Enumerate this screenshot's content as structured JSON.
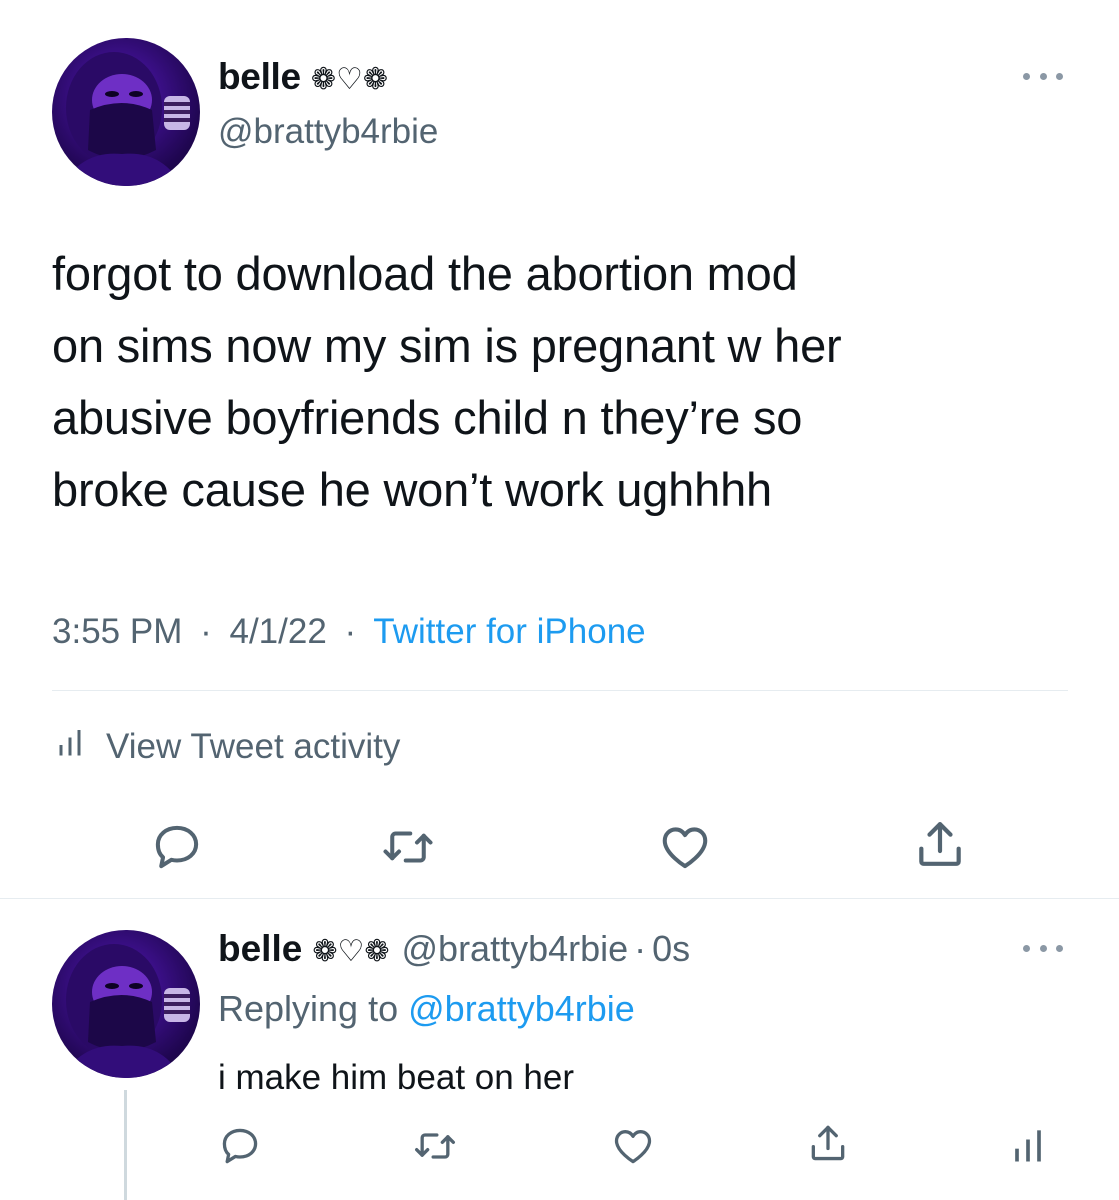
{
  "tweet": {
    "author_name": "belle",
    "name_decoration": "❁♡❁",
    "handle": "@brattyb4rbie",
    "text_lines": [
      "forgot to download the abortion mod",
      "on sims now my sim is pregnant w her",
      "abusive boyfriends child n they’re so",
      "broke cause he won’t work ughhhh"
    ],
    "time": "3:55 PM",
    "date": "4/1/22",
    "source": "Twitter for iPhone",
    "separator": "·",
    "activity_label": "View Tweet activity"
  },
  "reply": {
    "author_name": "belle",
    "name_decoration": "❁♡❁",
    "handle": "@brattyb4rbie",
    "age": "0s",
    "separator": "·",
    "replying_prefix": "Replying to",
    "replying_to": "@brattyb4rbie",
    "text": "i make him beat on her"
  },
  "icons": {
    "more": "more-horizontal-icon",
    "reply": "comment-icon",
    "retweet": "retweet-icon",
    "like": "heart-icon",
    "share": "share-icon",
    "activity": "bar-chart-icon"
  },
  "colors": {
    "text": "#0f1419",
    "secondary": "#536471",
    "link": "#1d9bf0",
    "divider": "#e6ecf0"
  }
}
